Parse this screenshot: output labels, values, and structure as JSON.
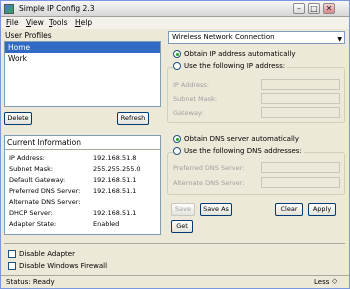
{
  "window": {
    "title": "Simple IP Config 2.3"
  },
  "menu": [
    {
      "u": "F",
      "rest": "ile"
    },
    {
      "u": "V",
      "rest": "iew"
    },
    {
      "u": "T",
      "rest": "ools"
    },
    {
      "u": "H",
      "rest": "elp"
    }
  ],
  "profiles": {
    "label": "User Profiles",
    "items": [
      "Home",
      "Work"
    ],
    "selected": "Home",
    "delete_label": "Delete",
    "refresh_label": "Refresh"
  },
  "current": {
    "header": "Current Information",
    "rows": [
      {
        "label": "IP Address:",
        "value": "192.168.51.8"
      },
      {
        "label": "Subnet Mask:",
        "value": "255.255.255.0"
      },
      {
        "label": "Default Gateway:",
        "value": "192.168.51.1"
      },
      {
        "label": "Preferred DNS Server:",
        "value": "192.168.51.1"
      },
      {
        "label": "Alternate DNS Server:",
        "value": ""
      },
      {
        "label": "DHCP Server:",
        "value": "192.168.51.1"
      },
      {
        "label": "Adapter State:",
        "value": "Enabled"
      }
    ]
  },
  "adapter": {
    "selected": "Wireless Network Connection"
  },
  "ip": {
    "auto_label": "Obtain IP address automatically",
    "manual_label": "Use the following IP address:",
    "auto_selected": true,
    "fields": [
      "IP Address:",
      "Subnet Mask:",
      "Gateway:"
    ]
  },
  "dns": {
    "auto_label": "Obtain DNS server automatically",
    "manual_label": "Use the following DNS addresses:",
    "auto_selected": true,
    "fields": [
      "Preferred DNS Server:",
      "Alternate DNS Server:"
    ]
  },
  "actions": {
    "save_label": "Save",
    "save_as_label": "Save As",
    "clear_label": "Clear",
    "apply_label": "Apply",
    "get_label": "Get"
  },
  "options": {
    "disable_adapter": "Disable Adapter",
    "disable_firewall": "Disable Windows Firewall"
  },
  "status": {
    "text": "Status: Ready",
    "less_label": "Less"
  },
  "colors": {
    "selection": "#316ac5",
    "radio_on": "#21a121"
  }
}
